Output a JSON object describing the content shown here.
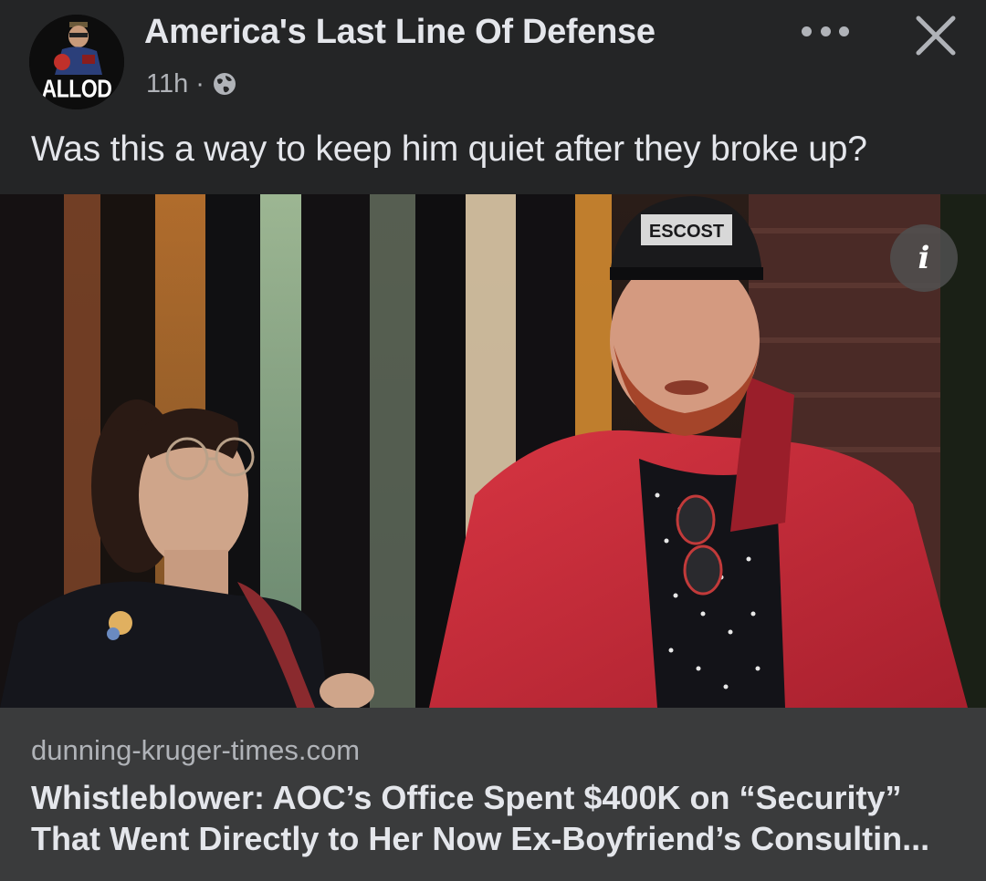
{
  "post": {
    "page_name": "America's Last Line Of Defense",
    "avatar_text": "ALLOD",
    "time": "11h",
    "separator": "·",
    "audience_icon": "globe-icon",
    "more_icon": "more-horizontal-icon",
    "close_icon": "close-icon",
    "caption": "Was this a way to keep him quiet after they broke up?"
  },
  "photo": {
    "info_icon": "info-icon",
    "info_glyph": "i",
    "cap_text": "ESCOST"
  },
  "link": {
    "domain": "dunning-kruger-times.com",
    "headline_line1": "Whistleblower: AOC’s Office Spent $400K on “Security”",
    "headline_line2": "That Went Directly to Her Now Ex-Boyfriend’s Consultin..."
  },
  "colors": {
    "background": "#242526",
    "link_footer": "#3a3b3c",
    "primary_text": "#e4e6eb",
    "secondary_text": "#b0b3b8"
  }
}
